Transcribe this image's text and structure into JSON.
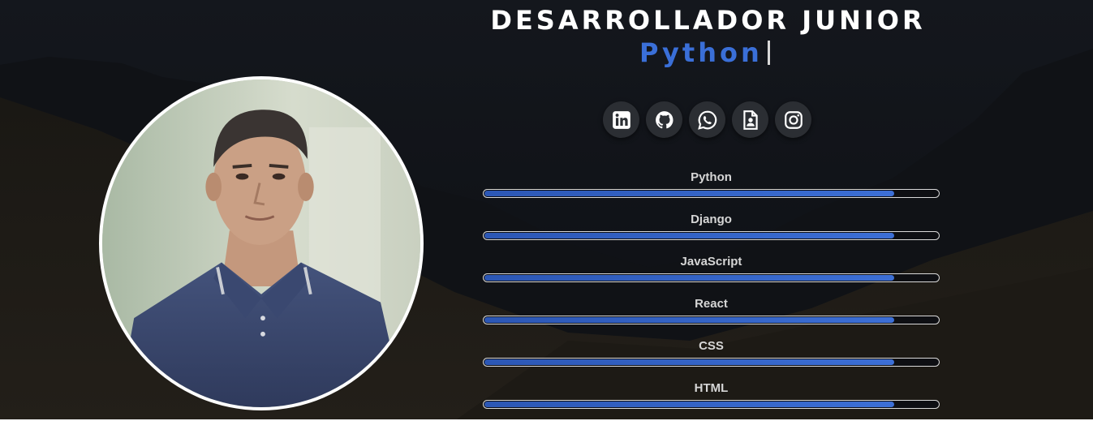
{
  "header": {
    "title": "DESARROLLADOR JUNIOR",
    "typed_word": "Python"
  },
  "profile": {
    "photo": "profile-photo"
  },
  "socials": [
    {
      "name": "linkedin",
      "icon": "linkedin-icon"
    },
    {
      "name": "github",
      "icon": "github-icon"
    },
    {
      "name": "whatsapp",
      "icon": "whatsapp-icon"
    },
    {
      "name": "cv",
      "icon": "resume-document-icon"
    },
    {
      "name": "instagram",
      "icon": "instagram-icon"
    }
  ],
  "skills": [
    {
      "label": "Python",
      "level": 0.9
    },
    {
      "label": "Django",
      "level": 0.9
    },
    {
      "label": "JavaScript",
      "level": 0.9
    },
    {
      "label": "React",
      "level": 0.9
    },
    {
      "label": "CSS",
      "level": 0.9
    },
    {
      "label": "HTML",
      "level": 0.9
    }
  ],
  "colors": {
    "accent": "#3a6fd8",
    "background": "#0b0c10",
    "title": "#ffffff",
    "bar_fill": "#2c57b5"
  }
}
